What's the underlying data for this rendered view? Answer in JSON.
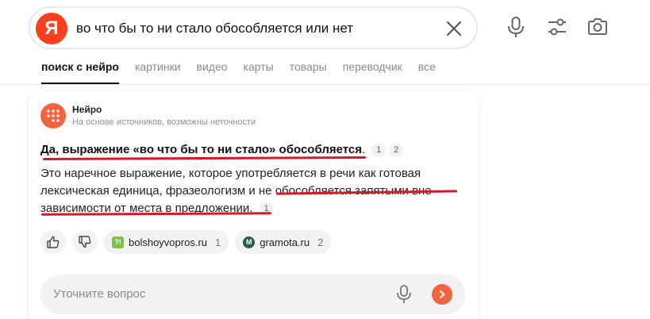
{
  "search": {
    "logo_letter": "Я",
    "query": "во что бы то ни стало обособляется или нет"
  },
  "tabs": [
    {
      "label": "поиск с нейро",
      "active": true
    },
    {
      "label": "картинки"
    },
    {
      "label": "видео"
    },
    {
      "label": "карты"
    },
    {
      "label": "товары"
    },
    {
      "label": "переводчик"
    },
    {
      "label": "все"
    }
  ],
  "answer": {
    "source_name": "Нейро",
    "source_subtitle": "На основе источников, возможны неточности",
    "title": "Да, выражение «во что бы то ни стало» обособляется",
    "title_end": ".",
    "title_cites": [
      "1",
      "2"
    ],
    "body_line1": "Это наречное выражение, которое употребляется в речи как готовая",
    "body_line2": "лексическая единица, фразеологизм и не обособляется запятыми вне",
    "body_line3": "зависимости от места в предложении",
    "body_end": ".",
    "body_cite": "1"
  },
  "sources": [
    {
      "name": "bolshoyvopros.ru",
      "count": "1",
      "icon": "bolshoyvopros-icon",
      "color": "#7cc242"
    },
    {
      "name": "gramota.ru",
      "count": "2",
      "icon": "gramota-icon",
      "color": "#2f5a4a"
    }
  ],
  "followup": {
    "placeholder": "Уточните вопрос"
  },
  "colors": {
    "brand": "#fc3f1d",
    "neiro_accent": "#f2643f",
    "annotation_underline": "#d4192a"
  }
}
